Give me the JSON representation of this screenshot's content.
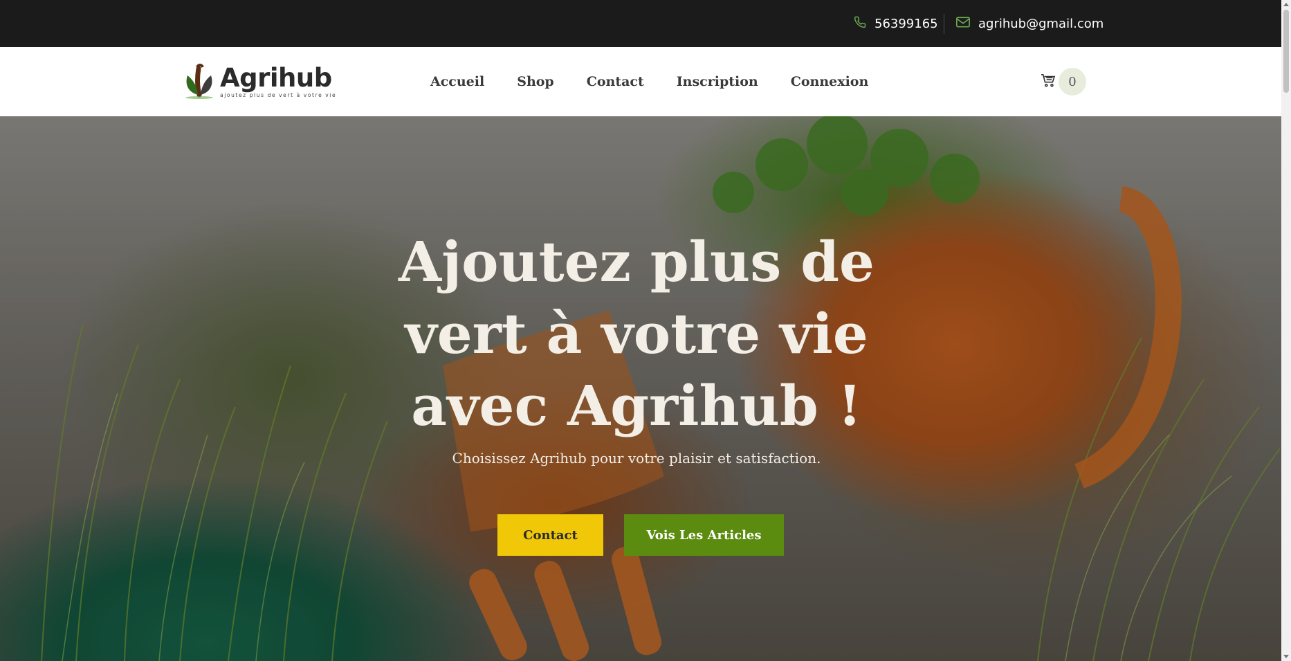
{
  "topbar": {
    "phone": "56399165",
    "email": "agrihub@gmail.com",
    "phone_icon": "phone-icon",
    "email_icon": "envelope-icon",
    "icon_color": "#6aa84f"
  },
  "brand": {
    "name": "Agrihub",
    "tagline": "ajoutez plus de vert à votre vie"
  },
  "nav": {
    "items": [
      {
        "label": "Accueil"
      },
      {
        "label": "Shop"
      },
      {
        "label": "Contact"
      },
      {
        "label": "Inscription"
      },
      {
        "label": "Connexion"
      }
    ]
  },
  "cart": {
    "icon": "cart-icon",
    "count": "0"
  },
  "hero": {
    "title": "Ajoutez plus de vert à votre vie avec Agrihub !",
    "subtitle": "Choisissez Agrihub pour votre plaisir et satisfaction.",
    "contact_button": "Contact",
    "articles_button": "Vois Les Articles"
  },
  "colors": {
    "topbar_bg": "#1b1b1b",
    "contact_button": "#f0c808",
    "articles_button": "#5b8c0f",
    "brand_green": "#2f6b1f"
  }
}
